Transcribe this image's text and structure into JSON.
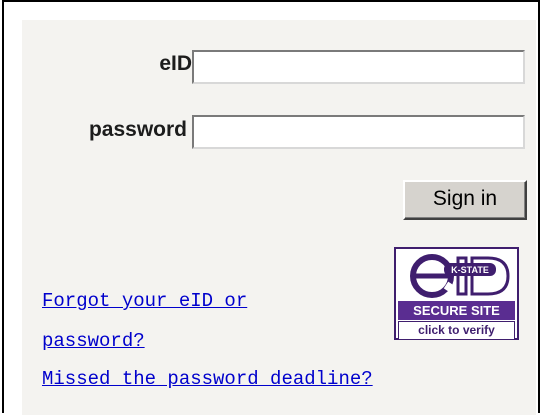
{
  "form": {
    "eid_label": "eID",
    "eid_value": "",
    "password_label": "password",
    "password_value": "",
    "signin_label": "Sign in"
  },
  "links": {
    "forgot_line1": "Forgot your eID or",
    "forgot_line2": "password?",
    "missed_deadline": "Missed the password deadline?"
  },
  "seal": {
    "logo_text": "eID K-STATE",
    "secure_label": "SECURE SITE",
    "verify_label": "click to verify"
  },
  "colors": {
    "link": "#0000cc",
    "seal_purple": "#5a2d91",
    "background": "#f4f3f0"
  }
}
